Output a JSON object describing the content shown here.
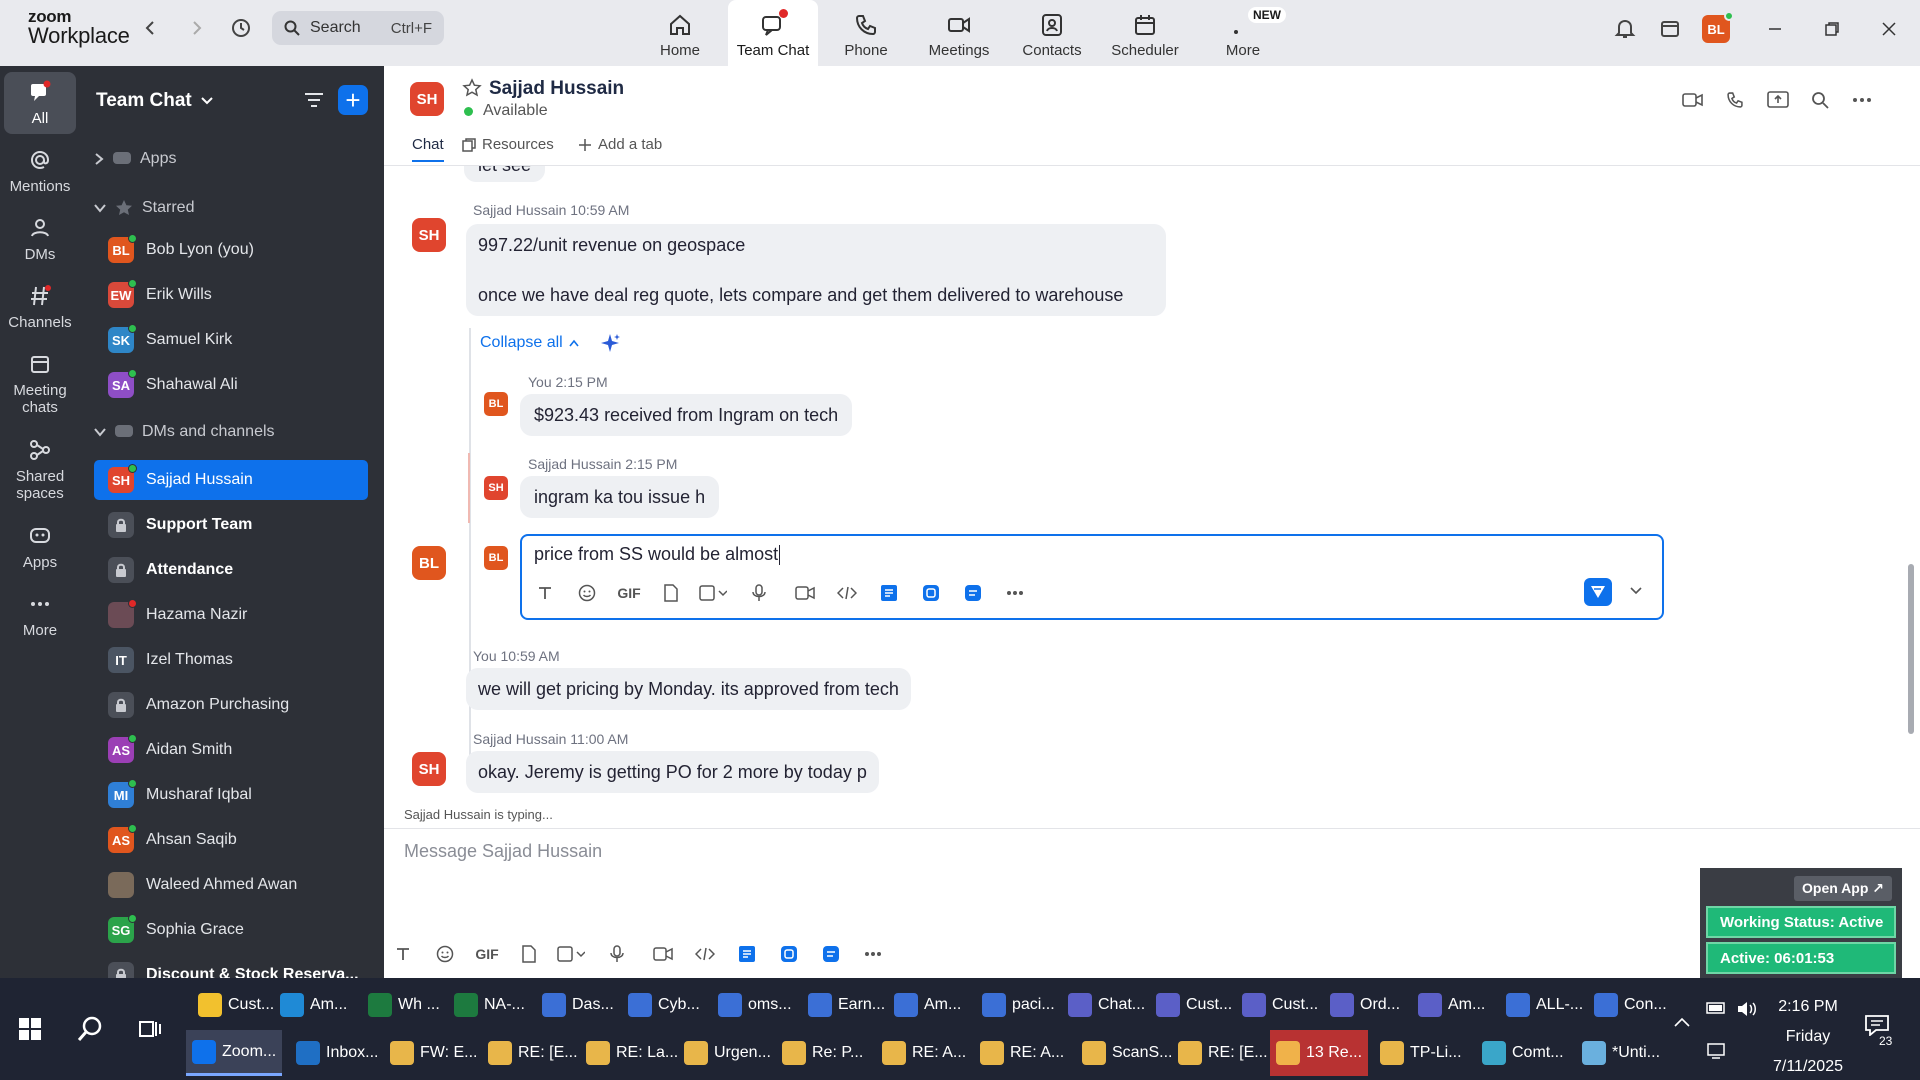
{
  "app": {
    "logo_line1": "zoom",
    "logo_line2": "Workplace",
    "search_placeholder": "Search",
    "search_shortcut": "Ctrl+F",
    "nav_tabs": [
      {
        "label": "Home",
        "icon": "home-icon"
      },
      {
        "label": "Team Chat",
        "icon": "chat-icon"
      },
      {
        "label": "Phone",
        "icon": "phone-icon"
      },
      {
        "label": "Meetings",
        "icon": "video-icon"
      },
      {
        "label": "Contacts",
        "icon": "contacts-icon"
      },
      {
        "label": "Scheduler",
        "icon": "calendar-icon"
      },
      {
        "label": "More",
        "icon": "more-icon"
      }
    ],
    "new_badge": "NEW",
    "user_initials": "BL",
    "accent": "#0e71eb"
  },
  "rail": [
    {
      "label": "All"
    },
    {
      "label": "Mentions"
    },
    {
      "label": "DMs"
    },
    {
      "label": "Channels"
    },
    {
      "label": "Meeting chats"
    },
    {
      "label": "Shared spaces"
    },
    {
      "label": "Apps"
    },
    {
      "label": "More"
    }
  ],
  "sidebar": {
    "title": "Team Chat",
    "sections": {
      "apps": "Apps",
      "starred": "Starred",
      "dms": "DMs and channels"
    },
    "starred": [
      {
        "initials": "BL",
        "name": "Bob Lyon (you)",
        "color": "#e0561e"
      },
      {
        "initials": "EW",
        "name": "Erik Wills",
        "color": "#d9493a"
      },
      {
        "initials": "SK",
        "name": "Samuel Kirk",
        "color": "#2e86c7"
      },
      {
        "initials": "SA",
        "name": "Shahawal Ali",
        "color": "#8e4ec6"
      }
    ],
    "dms": [
      {
        "initials": "SH",
        "name": "Sajjad Hussain",
        "color": "#e0452e",
        "type": "dm"
      },
      {
        "initials": "",
        "name": "Support Team",
        "type": "locked",
        "bold": true
      },
      {
        "initials": "",
        "name": "Attendance",
        "type": "locked",
        "bold": true
      },
      {
        "initials": "",
        "name": "Hazama Nazir",
        "color": "#6b4b55",
        "type": "photo"
      },
      {
        "initials": "IT",
        "name": "Izel Thomas",
        "color": "#4b5563",
        "type": "dm"
      },
      {
        "initials": "",
        "name": "Amazon Purchasing",
        "type": "locked"
      },
      {
        "initials": "AS",
        "name": "Aidan Smith",
        "color": "#9b3fb5",
        "type": "dm"
      },
      {
        "initials": "MI",
        "name": "Musharaf Iqbal",
        "color": "#2f7fd6",
        "type": "dm"
      },
      {
        "initials": "AS",
        "name": "Ahsan Saqib",
        "color": "#e0561e",
        "type": "dm"
      },
      {
        "initials": "",
        "name": "Waleed Ahmed Awan",
        "color": "#7a6a5a",
        "type": "photo"
      },
      {
        "initials": "SG",
        "name": "Sophia Grace",
        "color": "#2ba34a",
        "type": "dm"
      },
      {
        "initials": "",
        "name": "Discount & Stock Reserva...",
        "type": "locked",
        "bold": true
      }
    ]
  },
  "chat": {
    "initials": "SH",
    "name": "Sajjad Hussain",
    "status": "Available",
    "tabs": [
      "Chat",
      "Resources",
      "Add a tab"
    ],
    "partial_text": "let see",
    "msg1": {
      "sender": "Sajjad Hussain",
      "time": "10:59 AM",
      "line1": "997.22/unit revenue on geospace",
      "line2": "once we have deal reg quote, lets compare and get them delivered to warehouse"
    },
    "collapse_label": "Collapse all",
    "thread": [
      {
        "sender": "You",
        "time": "2:15 PM",
        "initials": "BL",
        "text": "$923.43 received from Ingram on tech"
      },
      {
        "sender": "Sajjad Hussain",
        "time": "2:15 PM",
        "initials": "SH",
        "text": "ingram ka tou issue h"
      }
    ],
    "reply_draft": "price from SS would be almost",
    "reply_initials": "BL",
    "msg2": {
      "sender": "You",
      "time": "10:59 AM",
      "initials": "BL",
      "text": "we will get pricing by Monday. its approved from tech"
    },
    "msg3": {
      "sender": "Sajjad Hussain",
      "time": "11:00 AM",
      "initials": "SH",
      "text": "okay. Jeremy is getting PO for 2 more by today p"
    },
    "typing": "Sajjad Hussain is typing...",
    "composer_placeholder": "Message Sajjad Hussain",
    "gif_label": "GIF"
  },
  "widget": {
    "open_app": "Open App ↗",
    "working_status": "Working Status: Active",
    "active_timer": "Active: 06:01:53"
  },
  "taskbar": {
    "row1": [
      {
        "label": "Cust...",
        "color": "#f2c12e"
      },
      {
        "label": "Am...",
        "color": "#1f8ad6"
      },
      {
        "label": "Wh ...",
        "color": "#1d7a3f"
      },
      {
        "label": "NA-...",
        "color": "#1d7a3f"
      },
      {
        "label": "Das...",
        "color": "#3b6fd6"
      },
      {
        "label": "Cyb...",
        "color": "#3b6fd6"
      },
      {
        "label": "oms...",
        "color": "#3b6fd6"
      },
      {
        "label": "Earn...",
        "color": "#3b6fd6"
      },
      {
        "label": "Am...",
        "color": "#3b6fd6"
      },
      {
        "label": "paci...",
        "color": "#3b6fd6"
      },
      {
        "label": "Chat...",
        "color": "#5b5fc7"
      },
      {
        "label": "Cust...",
        "color": "#5b5fc7"
      },
      {
        "label": "Cust...",
        "color": "#5b5fc7"
      },
      {
        "label": "Ord...",
        "color": "#5b5fc7"
      },
      {
        "label": "Am...",
        "color": "#5b5fc7"
      },
      {
        "label": "ALL-...",
        "color": "#3b6fd6"
      },
      {
        "label": "Con...",
        "color": "#3b6fd6"
      }
    ],
    "row2": [
      {
        "label": "Zoom...",
        "color": "#0e71eb"
      },
      {
        "label": "Inbox...",
        "color": "#1f6fc4"
      },
      {
        "label": "FW: E...",
        "color": "#e8b64a"
      },
      {
        "label": "RE: [E...",
        "color": "#e8b64a"
      },
      {
        "label": "RE: La...",
        "color": "#e8b64a"
      },
      {
        "label": "Urgen...",
        "color": "#e8b64a"
      },
      {
        "label": "Re: P...",
        "color": "#e8b64a"
      },
      {
        "label": "RE: A...",
        "color": "#e8b64a"
      },
      {
        "label": "RE: A...",
        "color": "#e8b64a"
      },
      {
        "label": "ScanS...",
        "color": "#e8b64a"
      },
      {
        "label": "RE: [E...",
        "color": "#e8b64a"
      },
      {
        "label": "13 Re...",
        "color": "#f0b24a"
      },
      {
        "label": "TP-Li...",
        "color": "#e8b64a"
      },
      {
        "label": "Comt...",
        "color": "#3aa6c9"
      },
      {
        "label": "*Unti...",
        "color": "#6ab0de"
      }
    ],
    "clock_time": "2:16 PM",
    "clock_day": "Friday",
    "clock_date": "7/11/2025",
    "notif_count": "23"
  }
}
